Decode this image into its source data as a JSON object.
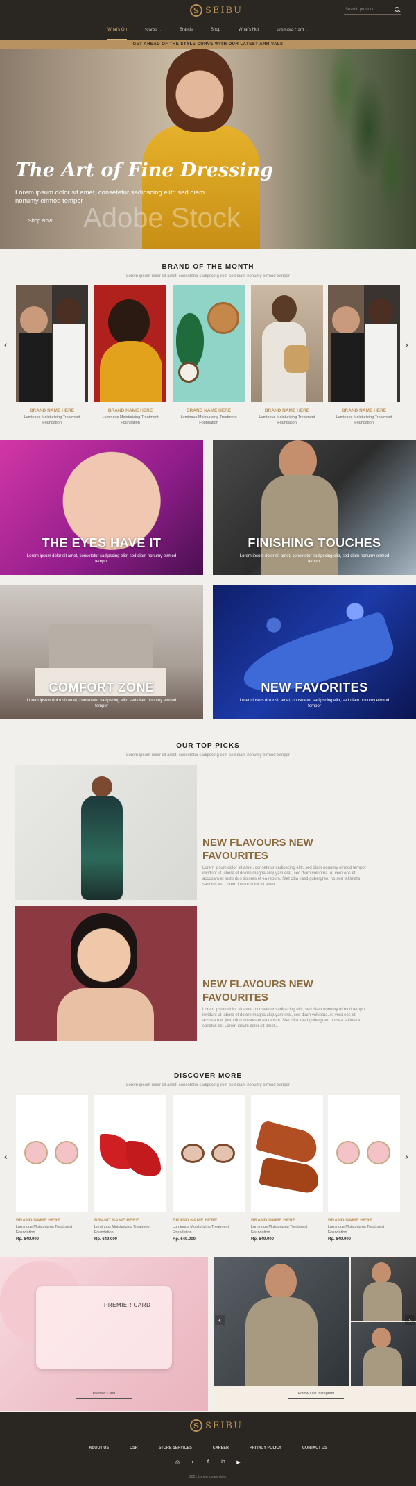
{
  "brand": {
    "name": "SEIBU",
    "mark": "S"
  },
  "search": {
    "placeholder": "Search product"
  },
  "nav": [
    "What's On",
    "Stores",
    "Brands",
    "Shop",
    "What's Hot",
    "Premiere Card"
  ],
  "promo": "GET AHEAD OF THE STYLE CURVE WITH OUR LATEST ARRIVALS",
  "hero": {
    "title": "The Art of Fine Dressing",
    "subtitle": "Lorem ipsum dolor sit amet, consetetur sadipscing elitr, sed diam nonumy eirmod tempor",
    "button": "Shop Now",
    "watermark": "Adobe Stock"
  },
  "brand_month": {
    "title": "BRAND OF THE MONTH",
    "subtitle": "Lorem ipsum dolor sit amet, consetetur sadipscing elitr, sed diam nonumy eirmod tempor",
    "cards": [
      {
        "name": "BRAND NAME HERE",
        "desc": "Luminous Moisturizing Treatment Foundation"
      },
      {
        "name": "BRAND NAME HERE",
        "desc": "Luminous Moisturizing Treatment Foundation"
      },
      {
        "name": "BRAND NAME HERE",
        "desc": "Luminous Moisturizing Treatment Foundation"
      },
      {
        "name": "BRAND NAME HERE",
        "desc": "Luminous Moisturizing Treatment Foundation"
      },
      {
        "name": "BRAND NAME HERE",
        "desc": "Luminous Moisturizing Treatment Foundation"
      }
    ]
  },
  "tiles": [
    {
      "title": "THE EYES HAVE IT",
      "desc": "Lorem ipsum dolor sit amet, consetetur sadipscing elitr, sed diam nonumy eirmod tempor"
    },
    {
      "title": "FINISHING TOUCHES",
      "desc": "Lorem ipsum dolor sit amet, consetetur sadipscing elitr, sed diam nonumy eirmod tempor"
    },
    {
      "title": "COMFORT ZONE",
      "desc": "Lorem ipsum dolor sit amet, consetetur sadipscing elitr, sed diam nonumy eirmod tempor"
    },
    {
      "title": "NEW FAVORITES",
      "desc": "Lorem ipsum dolor sit amet, consetetur sadipscing elitr, sed diam nonumy eirmod tempor"
    }
  ],
  "top_picks": {
    "title": "OUR TOP PICKS",
    "subtitle": "Lorem ipsum dolor sit amet, consetetur sadipscing elitr, sed diam nonumy eirmod tempor",
    "items": [
      {
        "title": "NEW FLAVOURS NEW FAVOURITES",
        "text": "Lorem ipsum dolor sit amet, consetetur sadipscing elitr, sed diam nonumy eirmod tempor invidunt ut labore et dolore magna aliquyam erat, sed diam voluptua. At vero eos et accusam et justo duo dolores et ea rebum. Stet clita kasd gubergren, no sea takimata sanctus est Lorem ipsum dolor sit amet..."
      },
      {
        "title": "NEW FLAVOURS NEW FAVOURITES",
        "text": "Lorem ipsum dolor sit amet, consetetur sadipscing elitr, sed diam nonumy eirmod tempor invidunt ut labore et dolore magna aliquyam erat, sed diam voluptua. At vero eos et accusam et justo duo dolores et ea rebum. Stet clita kasd gubergren, no sea takimata sanctus est Lorem ipsum dolor sit amet..."
      }
    ]
  },
  "discover": {
    "title": "DISCOVER MORE",
    "subtitle": "Lorem ipsum dolor sit amet, consetetur sadipscing elitr, sed diam nonumy eirmod tempor",
    "cards": [
      {
        "name": "BRAND NAME HERE",
        "desc": "Luminous Moisturizing Treatment Foundation",
        "price": "Rp. 649.000"
      },
      {
        "name": "BRAND NAME HERE",
        "desc": "Luminous Moisturizing Treatment Foundation",
        "price": "Rp. 649.000"
      },
      {
        "name": "BRAND NAME HERE",
        "desc": "Luminous Moisturizing Treatment Foundation",
        "price": "Rp. 649.000"
      },
      {
        "name": "BRAND NAME HERE",
        "desc": "Luminous Moisturizing Treatment Foundation",
        "price": "Rp. 649.000"
      },
      {
        "name": "BRAND NAME HERE",
        "desc": "Luminous Moisturizing Treatment Foundation",
        "price": "Rp. 649.000"
      }
    ]
  },
  "premium": {
    "card_label": "PREMIER CARD",
    "button": "Premier Card"
  },
  "instagram": {
    "button": "Follow Our Instagram"
  },
  "footer": {
    "links": [
      "ABOUT US",
      "CSR",
      "STORE SERVICES",
      "CAREER",
      "PRIVACY POLICY",
      "CONTACT US"
    ],
    "social": [
      "instagram-icon",
      "twitter-icon",
      "facebook-icon",
      "linkedin-icon",
      "youtube-icon"
    ],
    "copyright": "2021 Lorem ipsum dolor"
  },
  "colors": {
    "dark": "#2a2622",
    "gold": "#b8935f",
    "brown_title": "#8a6a3c"
  }
}
